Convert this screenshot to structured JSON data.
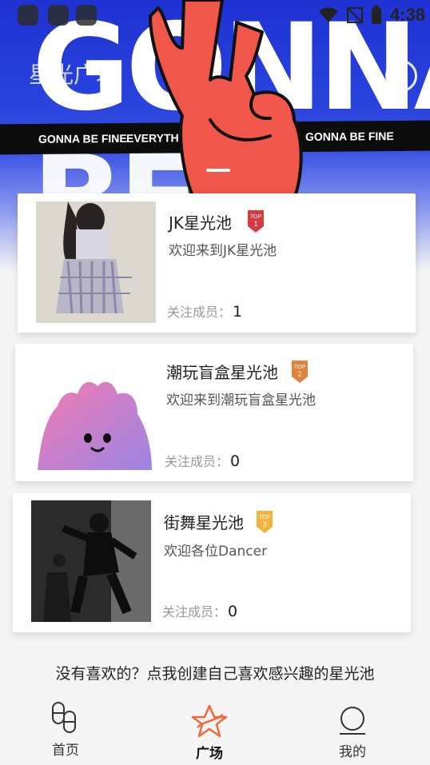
{
  "status_bar": {
    "time": "4:38"
  },
  "hero": {
    "word_top": "GONNA",
    "word_bottom": "BE FINE",
    "ribbon_texts": [
      "GONNA BE FINE",
      "EVERYTHING CAN BE ALRIGHT",
      "GONNA BE FINE"
    ]
  },
  "header": {
    "title": "星光广场"
  },
  "pools": [
    {
      "name": "JK星光池",
      "desc": "欢迎来到JK星光池",
      "member_label": "关注成员：",
      "member_count": "1",
      "badge": {
        "top": "TOP",
        "rank": "1",
        "color": "#d9383f"
      }
    },
    {
      "name": "潮玩盲盒星光池",
      "desc": "欢迎来到潮玩盲盒星光池",
      "member_label": "关注成员：",
      "member_count": "0",
      "badge": {
        "top": "TOP",
        "rank": "2",
        "color": "#e3833a"
      }
    },
    {
      "name": "街舞星光池",
      "desc": "欢迎各位Dancer",
      "member_label": "关注成员：",
      "member_count": "0",
      "badge": {
        "top": "TOP",
        "rank": "3",
        "color": "#f2b43c"
      }
    }
  ],
  "create_prompt": "没有喜欢的？点我创建自己喜欢感兴趣的星光池",
  "tabs": [
    {
      "label": "首页",
      "icon": "home-capsule-icon"
    },
    {
      "label": "广场",
      "icon": "star-plaza-icon",
      "active": true
    },
    {
      "label": "我的",
      "icon": "profile-icon"
    }
  ],
  "colors": {
    "accent": "#f0683c",
    "hero_blue": "#2742dc"
  }
}
